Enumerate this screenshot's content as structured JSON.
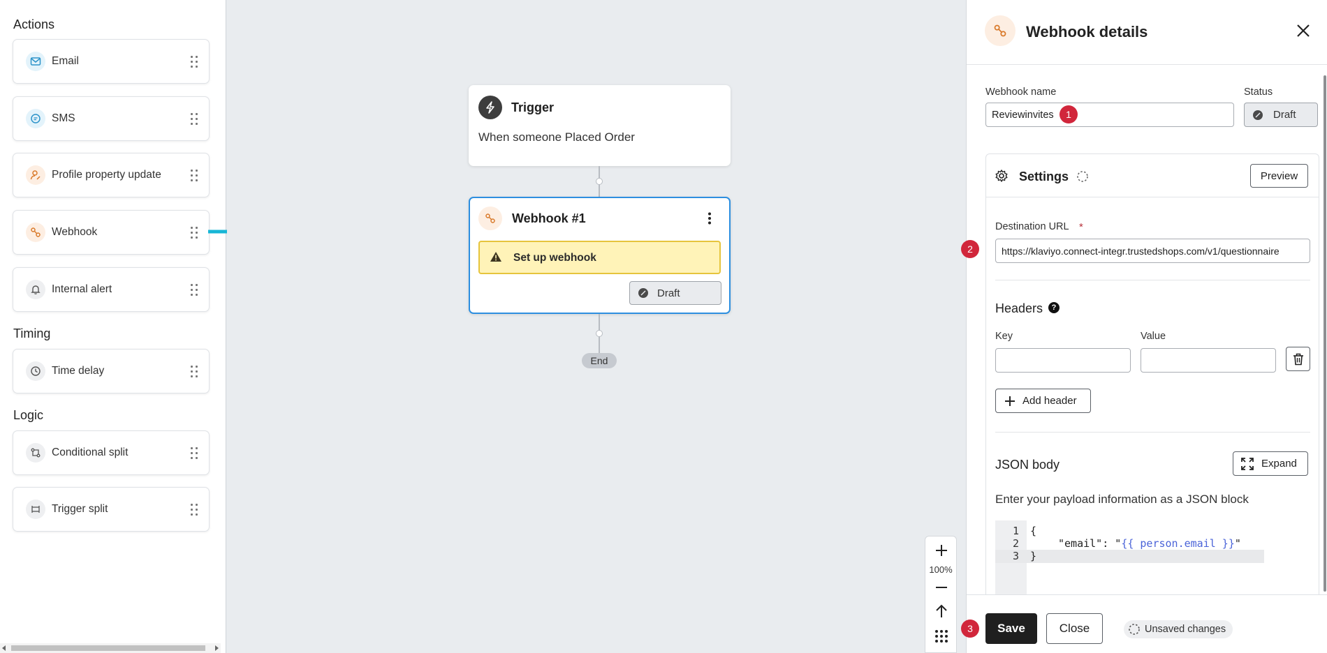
{
  "sidebar": {
    "sections": {
      "actions": "Actions",
      "timing": "Timing",
      "logic": "Logic"
    },
    "items": [
      {
        "label": "Email",
        "icon": "mail-icon"
      },
      {
        "label": "SMS",
        "icon": "chat-icon"
      },
      {
        "label": "Profile property update",
        "icon": "user-edit-icon"
      },
      {
        "label": "Webhook",
        "icon": "webhook-icon"
      },
      {
        "label": "Internal alert",
        "icon": "bell-icon"
      },
      {
        "label": "Time delay",
        "icon": "clock-icon"
      },
      {
        "label": "Conditional split",
        "icon": "split-icon"
      },
      {
        "label": "Trigger split",
        "icon": "trigger-split-icon"
      }
    ]
  },
  "canvas": {
    "trigger": {
      "title": "Trigger",
      "description": "When someone Placed Order"
    },
    "webhook_node": {
      "title": "Webhook #1",
      "warning": "Set up webhook",
      "status": "Draft"
    },
    "end_label": "End",
    "zoom": {
      "level": "100%"
    }
  },
  "panel": {
    "title": "Webhook details",
    "webhook_name_label": "Webhook name",
    "webhook_name_value": "Reviewinvites",
    "status_label": "Status",
    "status_value": "Draft",
    "settings": {
      "title": "Settings",
      "preview_label": "Preview"
    },
    "destination": {
      "label": "Destination URL",
      "required_mark": "*",
      "value": "https://klaviyo.connect-integr.trustedshops.com/v1/questionnaire"
    },
    "headers": {
      "title": "Headers",
      "key_label": "Key",
      "value_label": "Value",
      "add_label": "Add header"
    },
    "json_body": {
      "title": "JSON body",
      "expand_label": "Expand",
      "hint": "Enter your payload information as a JSON block",
      "lines": [
        {
          "num": "1",
          "plain": "{",
          "key": "",
          "template": "",
          "close": ""
        },
        {
          "num": "2",
          "plain": "",
          "key": "\"email\": \"",
          "template": "{{ person.email }}",
          "close": "\""
        },
        {
          "num": "3",
          "plain": "}",
          "key": "",
          "template": "",
          "close": ""
        }
      ]
    },
    "footer": {
      "save_label": "Save",
      "close_label": "Close",
      "unsaved_label": "Unsaved changes"
    },
    "badges": [
      "1",
      "2",
      "3"
    ]
  },
  "colors": {
    "accent_arrow": "#17b6d6",
    "badge_red": "#d1263b",
    "warning_bg": "#fff3b8",
    "warning_border": "#e6c43c",
    "save_bg": "#1f1f1f",
    "node_selected_border": "#2d8fe0",
    "json_template": "#4a63d8"
  }
}
